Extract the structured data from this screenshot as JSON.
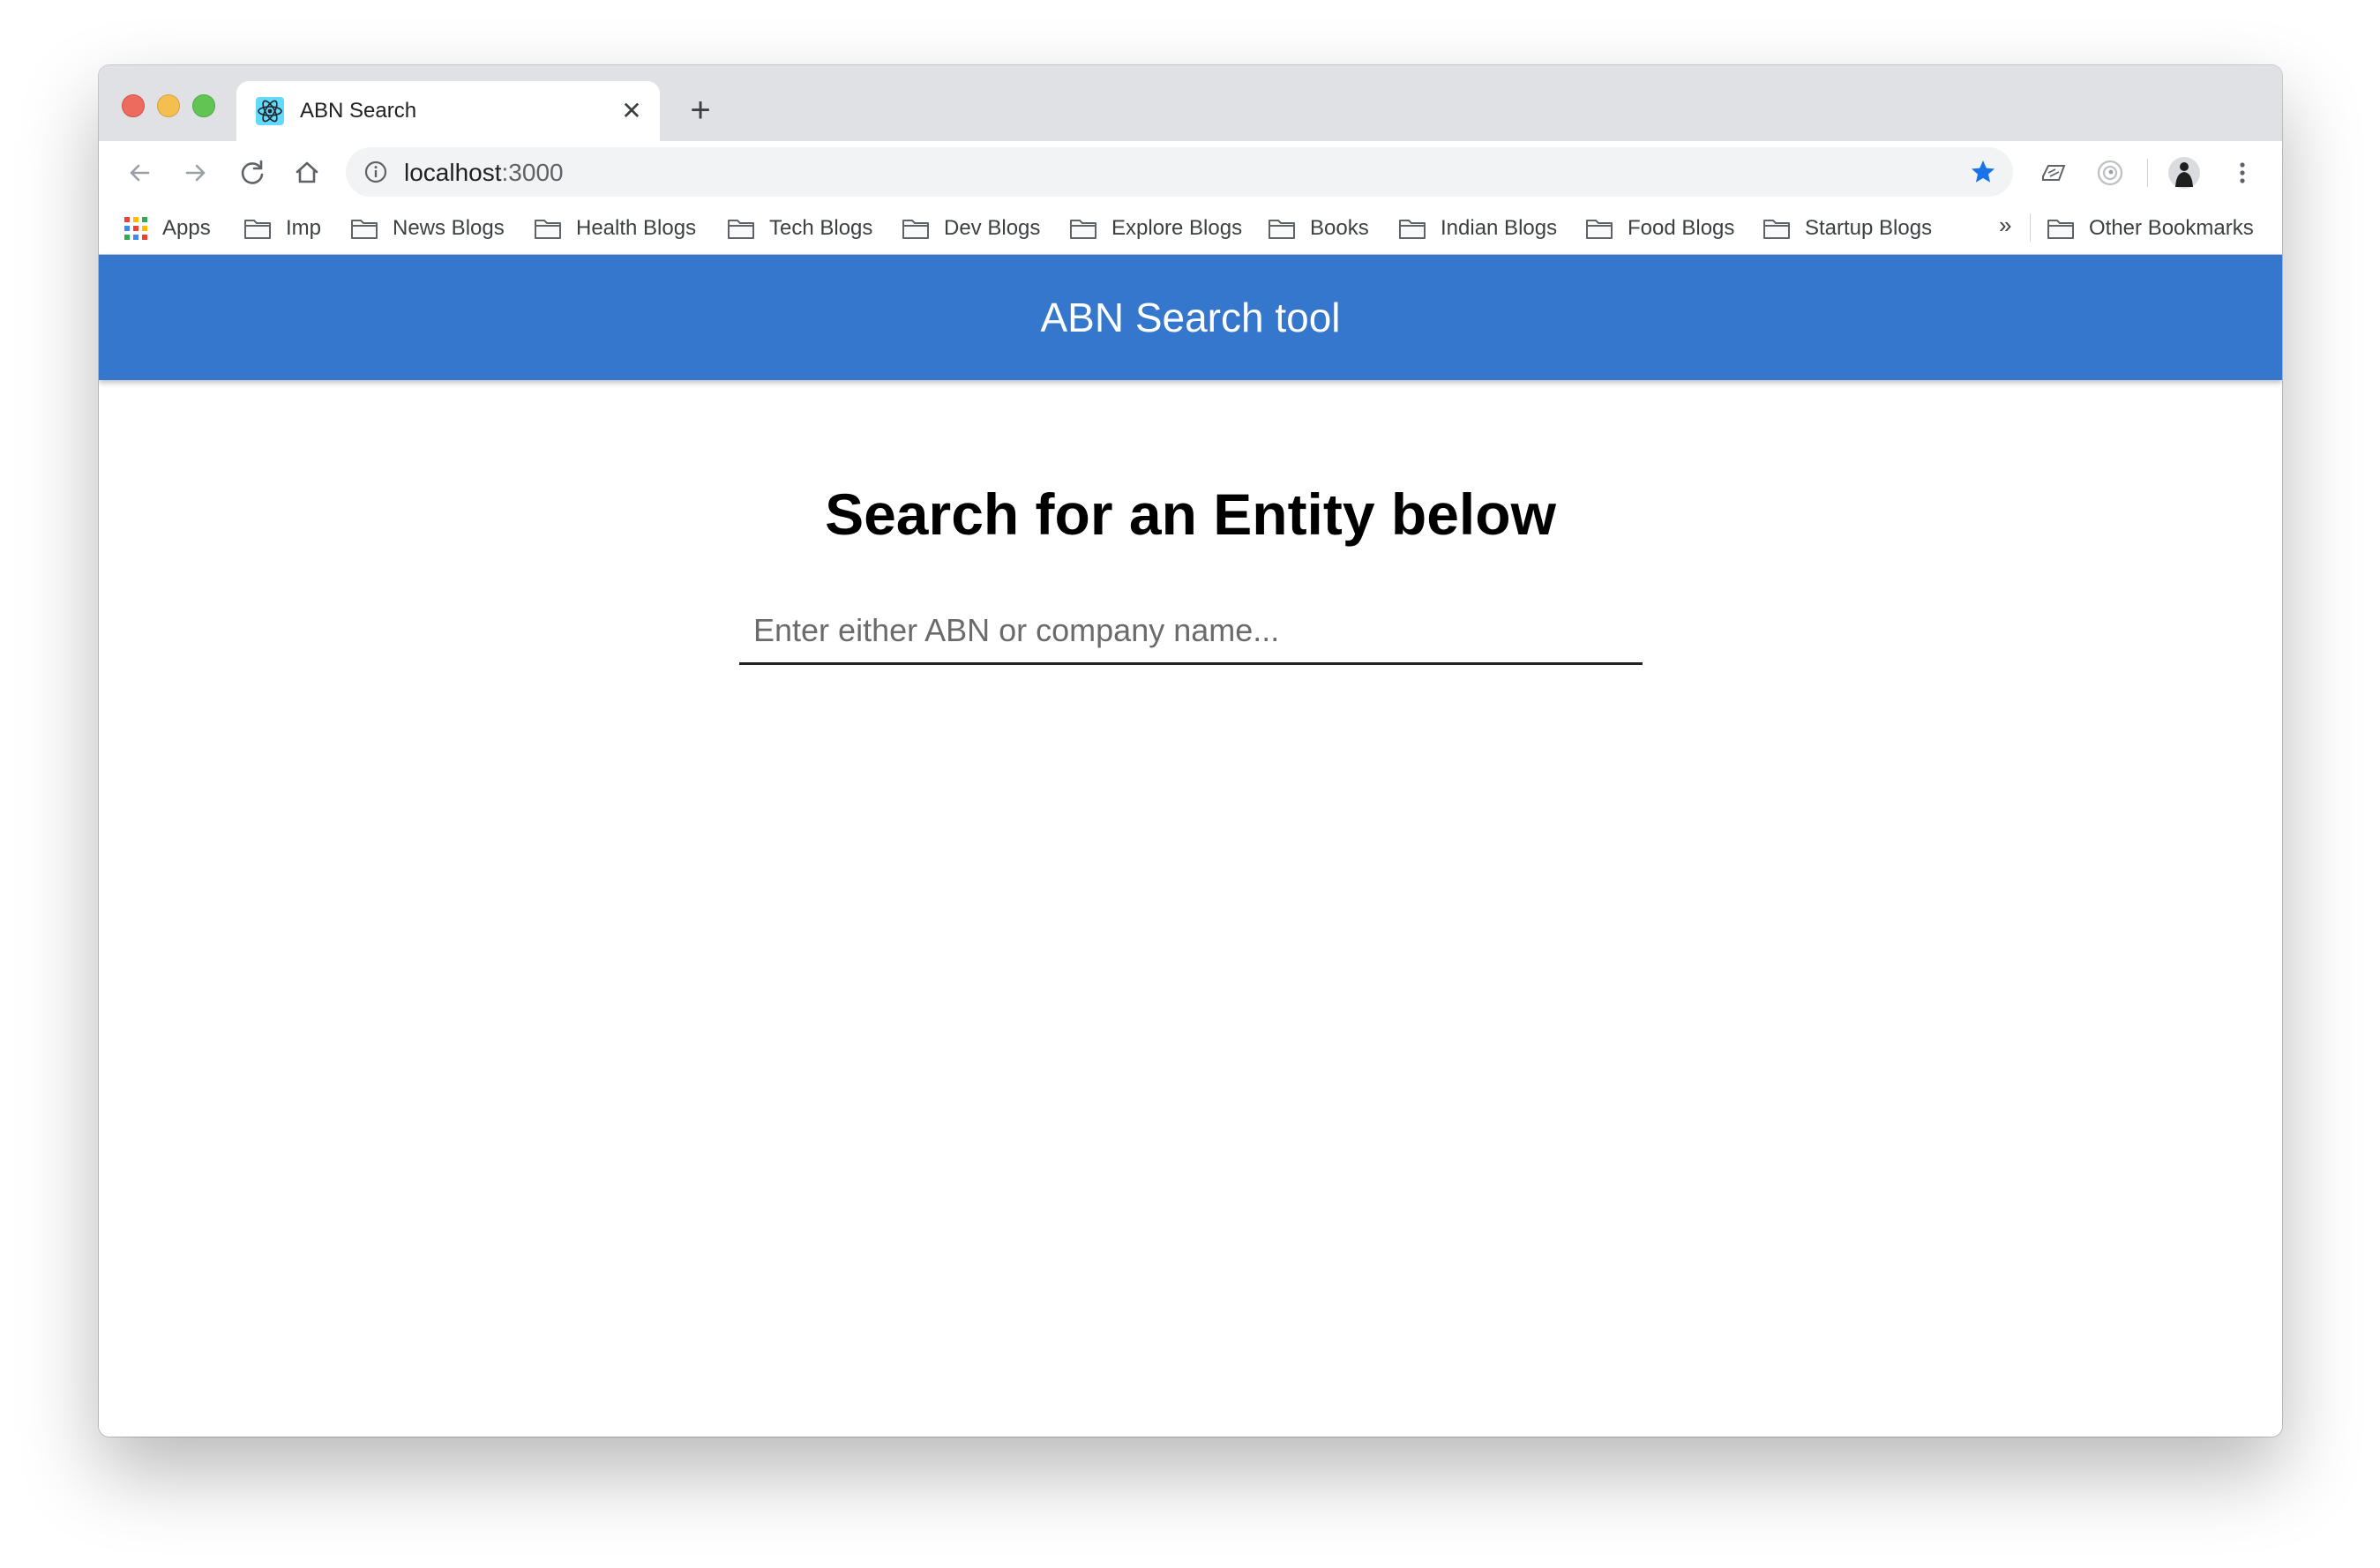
{
  "browser": {
    "tab": {
      "title": "ABN Search",
      "favicon": "react-icon"
    },
    "address": {
      "host": "localhost",
      "port": ":3000"
    },
    "bookmarks": [
      {
        "label": "Apps",
        "icon": "apps-grid-icon"
      },
      {
        "label": "Imp",
        "icon": "folder-icon"
      },
      {
        "label": "News Blogs",
        "icon": "folder-icon"
      },
      {
        "label": "Health Blogs",
        "icon": "folder-icon"
      },
      {
        "label": "Tech Blogs",
        "icon": "folder-icon"
      },
      {
        "label": "Dev Blogs",
        "icon": "folder-icon"
      },
      {
        "label": "Explore Blogs",
        "icon": "folder-icon"
      },
      {
        "label": "Books",
        "icon": "folder-icon"
      },
      {
        "label": "Indian Blogs",
        "icon": "folder-icon"
      },
      {
        "label": "Food Blogs",
        "icon": "folder-icon"
      },
      {
        "label": "Startup Blogs",
        "icon": "folder-icon"
      }
    ],
    "more_bookmarks": "»",
    "other_bookmarks": "Other Bookmarks"
  },
  "app": {
    "header_title": "ABN Search tool",
    "heading": "Search for an Entity below",
    "search": {
      "placeholder": "Enter either ABN or company name...",
      "value": ""
    }
  },
  "colors": {
    "header_bg": "#3477cd",
    "star": "#1a73e8"
  }
}
